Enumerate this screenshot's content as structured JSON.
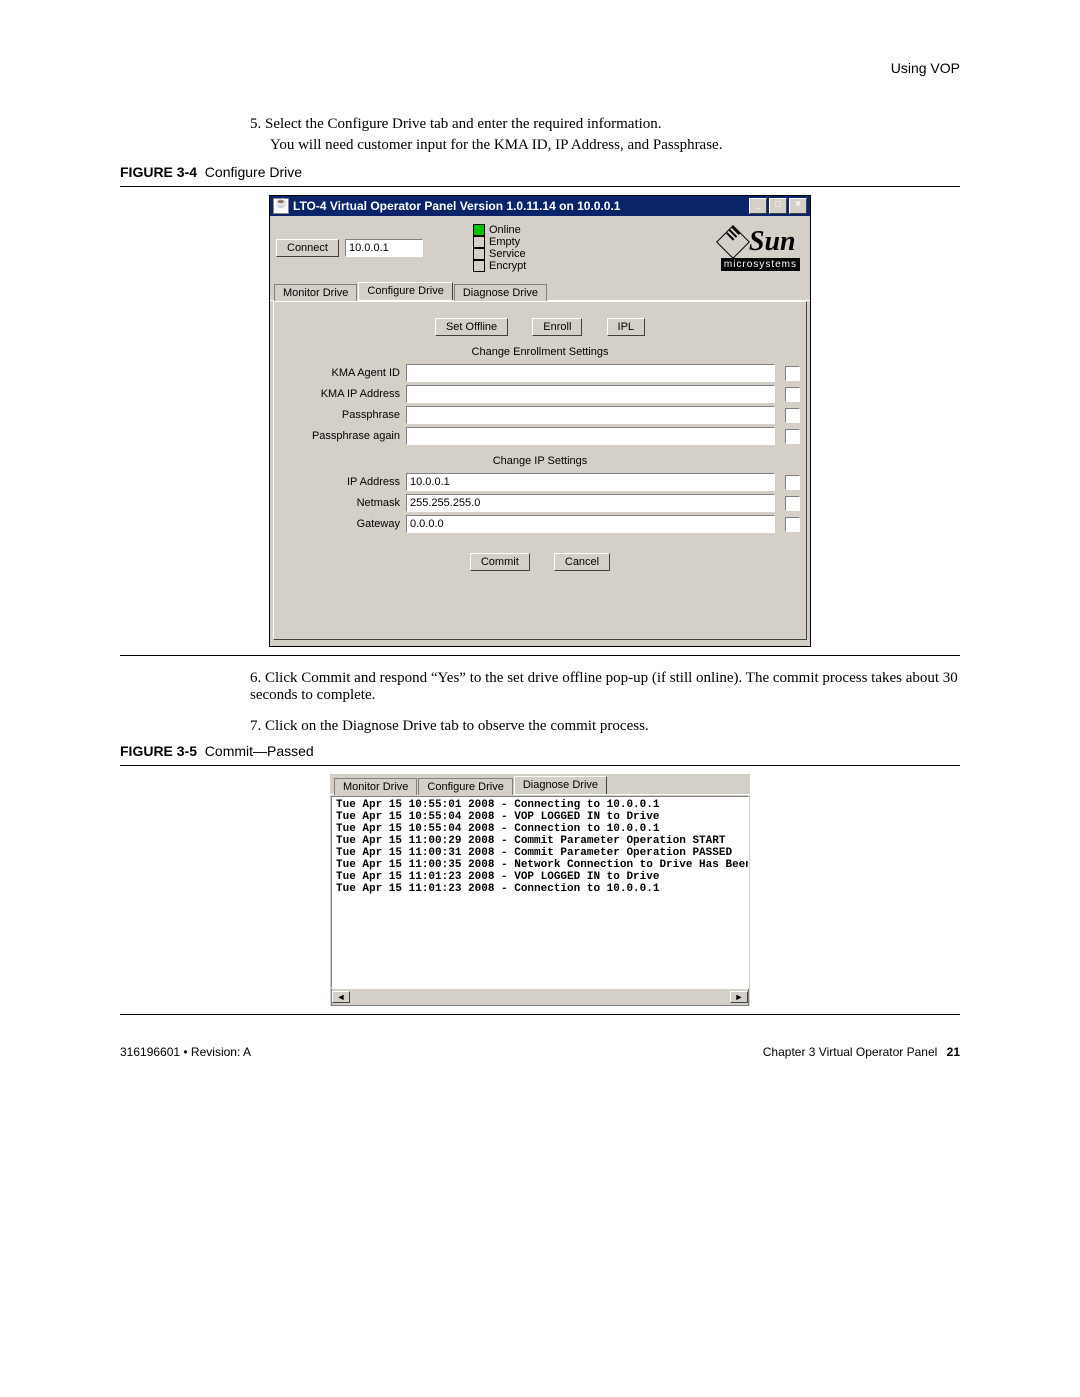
{
  "header": {
    "section": "Using VOP"
  },
  "step5": "5. Select the Configure Drive tab and enter the required information.",
  "step5_sub": "You will need customer input for the KMA ID, IP Address, and Passphrase.",
  "figure4": {
    "label": "FIGURE 3-4",
    "caption": "Configure Drive"
  },
  "window1": {
    "title": "LTO-4 Virtual Operator Panel Version 1.0.11.14 on 10.0.0.1",
    "winbtns": {
      "min": "_",
      "max": "□",
      "close": "×"
    },
    "connect_btn": "Connect",
    "connect_ip": "10.0.0.1",
    "status": {
      "online": "Online",
      "empty": "Empty",
      "service": "Service",
      "encrypt": "Encrypt"
    },
    "logo": {
      "sun": "Sun",
      "micro": "microsystems"
    },
    "tabs": {
      "monitor": "Monitor Drive",
      "configure": "Configure Drive",
      "diagnose": "Diagnose Drive"
    },
    "buttons": {
      "offline": "Set Offline",
      "enroll": "Enroll",
      "ipl": "IPL",
      "commit": "Commit",
      "cancel": "Cancel"
    },
    "section_enroll": "Change Enrollment Settings",
    "section_ip": "Change IP Settings",
    "fields": {
      "agent_label": "KMA Agent ID",
      "agent_val": "",
      "kmaip_label": "KMA IP Address",
      "kmaip_val": "",
      "pass_label": "Passphrase",
      "pass_val": "",
      "pass2_label": "Passphrase again",
      "pass2_val": "",
      "ip_label": "IP Address",
      "ip_val": "10.0.0.1",
      "mask_label": "Netmask",
      "mask_val": "255.255.255.0",
      "gw_label": "Gateway",
      "gw_val": "0.0.0.0"
    }
  },
  "step6": "6. Click Commit and respond “Yes” to the set drive offline pop-up (if still online). The commit process takes about 30 seconds to complete.",
  "step7": "7. Click on the Diagnose Drive tab to observe the commit process.",
  "figure5": {
    "label": "FIGURE 3-5",
    "caption": "Commit—Passed"
  },
  "window2": {
    "tabs": {
      "monitor": "Monitor Drive",
      "configure": "Configure Drive",
      "diagnose": "Diagnose Drive"
    },
    "log": "Tue Apr 15 10:55:01 2008 - Connecting to 10.0.0.1\nTue Apr 15 10:55:04 2008 - VOP LOGGED IN to Drive\nTue Apr 15 10:55:04 2008 - Connection to 10.0.0.1\nTue Apr 15 11:00:29 2008 - Commit Parameter Operation START\nTue Apr 15 11:00:31 2008 - Commit Parameter Operation PASSED\nTue Apr 15 11:00:35 2008 - Network Connection to Drive Has Been\nTue Apr 15 11:01:23 2008 - VOP LOGGED IN to Drive\nTue Apr 15 11:01:23 2008 - Connection to 10.0.0.1",
    "scroll": {
      "left": "◄",
      "right": "►"
    }
  },
  "footer": {
    "left": "316196601 • Revision: A",
    "right_chapter": "Chapter 3 Virtual Operator Panel",
    "right_page": "21"
  }
}
